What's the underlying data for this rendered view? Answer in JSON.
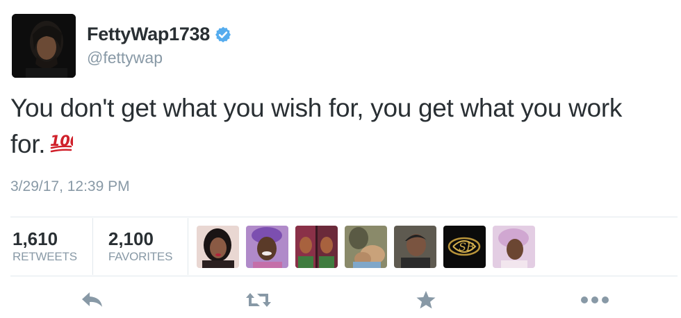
{
  "tweet": {
    "display_name": "FettyWap1738",
    "handle": "@fettywap",
    "text": "You don't get what you wish for, you get what you work for.",
    "emoji": "hundred-points-emoji",
    "timestamp": "3/29/17, 12:39 PM"
  },
  "stats": {
    "retweets": {
      "count": "1,610",
      "label": "RETWEETS"
    },
    "favorites": {
      "count": "2,100",
      "label": "FAVORITES"
    }
  },
  "favoriters": [
    {
      "name": "favoriter-avatar-1"
    },
    {
      "name": "favoriter-avatar-2"
    },
    {
      "name": "favoriter-avatar-3"
    },
    {
      "name": "favoriter-avatar-4"
    },
    {
      "name": "favoriter-avatar-5"
    },
    {
      "name": "favoriter-avatar-6"
    },
    {
      "name": "favoriter-avatar-7"
    }
  ],
  "actions": [
    "reply-icon",
    "retweet-icon",
    "favorite-star-icon",
    "more-dots-icon"
  ],
  "colors": {
    "text": "#292f33",
    "secondary": "#8899a6",
    "verified": "#55acee",
    "action_icon": "#8899a6",
    "divider": "#e1e8ed",
    "emoji_red": "#d0202a"
  }
}
